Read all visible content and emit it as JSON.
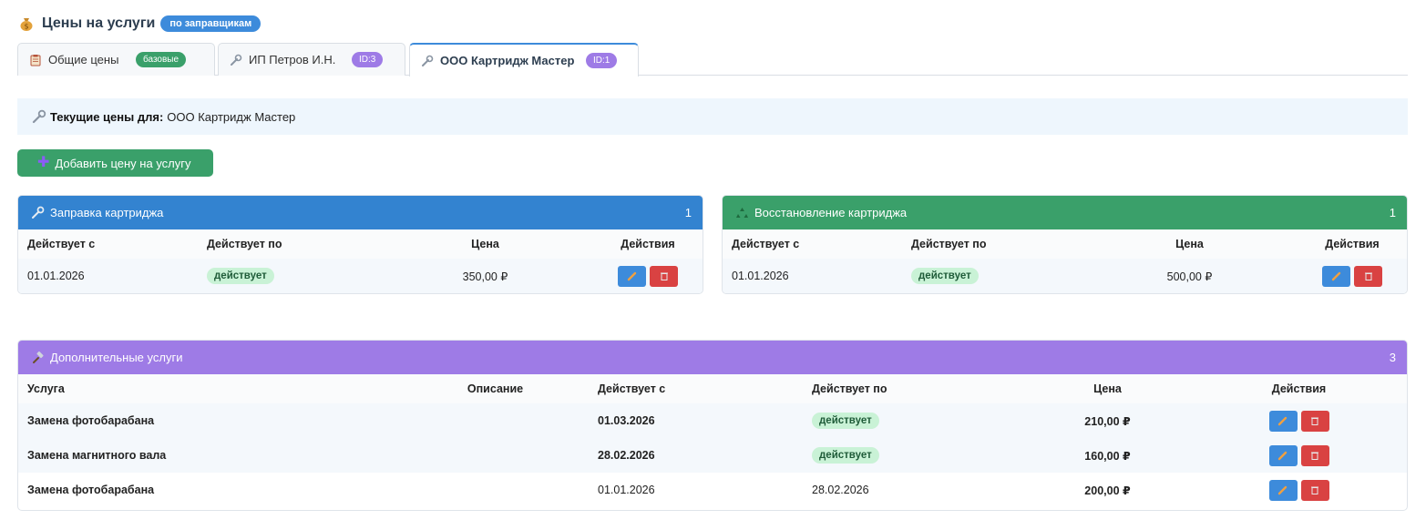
{
  "page": {
    "title": "Цены на услуги",
    "badge": "по заправщикам"
  },
  "tabs": [
    {
      "label": "Общие цены",
      "badge": "базовые",
      "badge_color": "#3aa06a",
      "icon": "clipboard-icon",
      "active": false
    },
    {
      "label": "ИП Петров И.Н.",
      "badge": "ID:3",
      "badge_color": "#9e7be6",
      "icon": "wrench-icon",
      "active": false
    },
    {
      "label": "ООО Картридж Мастер",
      "badge": "ID:1",
      "badge_color": "#9e7be6",
      "icon": "wrench-icon",
      "active": true
    }
  ],
  "info": {
    "label": "Текущие цены для:",
    "value": "ООО Картридж Мастер"
  },
  "add_button": {
    "label": "Добавить цену на услугу"
  },
  "refill": {
    "title": "Заправка картриджа",
    "count": "1",
    "columns": [
      "Действует с",
      "Действует по",
      "Цена",
      "Действия"
    ],
    "rows": [
      {
        "from": "01.01.2026",
        "to": "действует",
        "price": "350,00 ₽"
      }
    ]
  },
  "restore": {
    "title": "Восстановление картриджа",
    "count": "1",
    "columns": [
      "Действует с",
      "Действует по",
      "Цена",
      "Действия"
    ],
    "rows": [
      {
        "from": "01.01.2026",
        "to": "действует",
        "price": "500,00 ₽"
      }
    ]
  },
  "extra": {
    "title": "Дополнительные услуги",
    "count": "3",
    "columns": [
      "Услуга",
      "Описание",
      "Действует с",
      "Действует по",
      "Цена",
      "Действия"
    ],
    "rows": [
      {
        "service": "Замена фотобарабана",
        "description": "",
        "from": "01.03.2026",
        "to": "действует",
        "price": "210,00 ₽"
      },
      {
        "service": "Замена магнитного вала",
        "description": "",
        "from": "28.02.2026",
        "to": "действует",
        "price": "160,00 ₽"
      },
      {
        "service": "Замена фотобарабана",
        "description": "",
        "from": "01.01.2026",
        "to": "28.02.2026",
        "price": "200,00 ₽"
      }
    ]
  },
  "colors": {
    "accent_blue": "#3383d0",
    "accent_green": "#3aa06a",
    "accent_purple": "#9e7be6",
    "delete_red": "#d94242",
    "active_pill": "#c9f2d6"
  }
}
